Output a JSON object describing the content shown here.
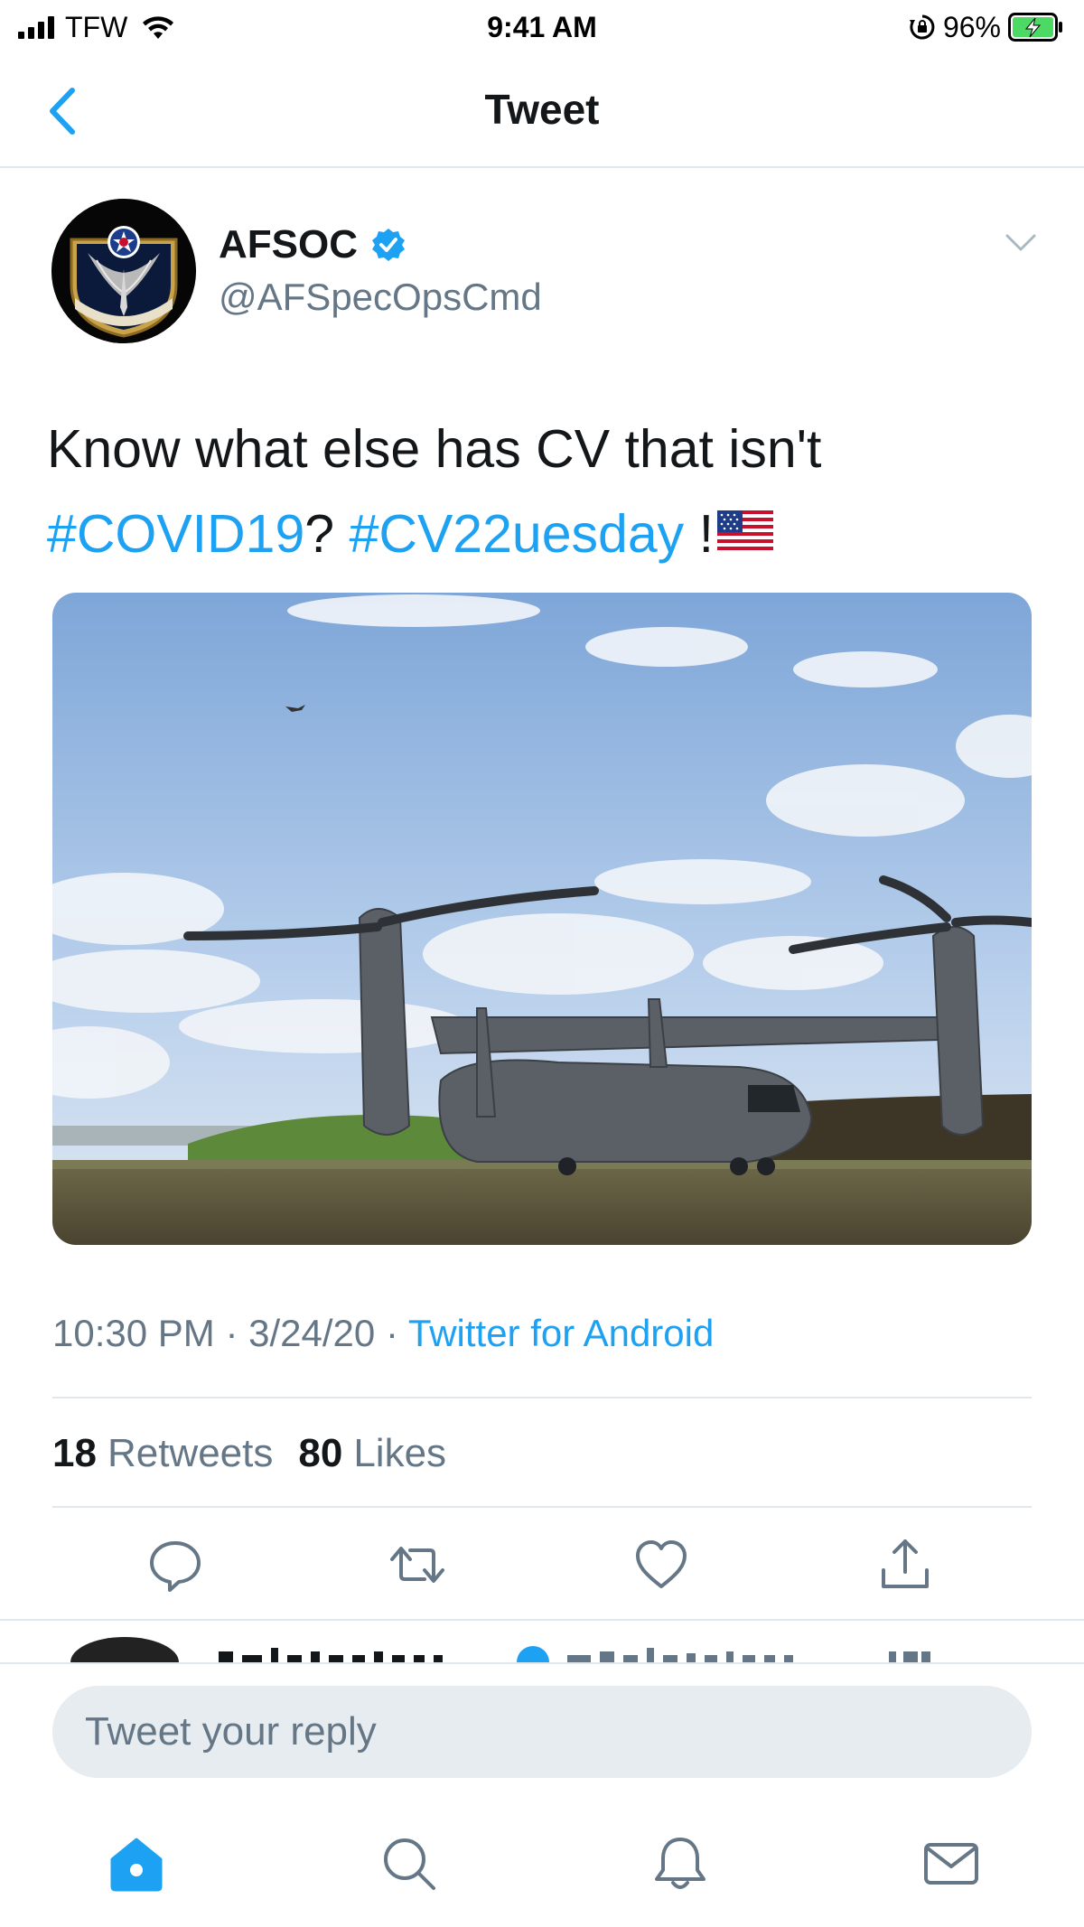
{
  "status_bar": {
    "carrier": "TFW",
    "time": "9:41 AM",
    "battery": "96%",
    "battery_color": "#4cd964"
  },
  "nav": {
    "title": "Tweet",
    "back_icon": "chevron-left-icon"
  },
  "tweet": {
    "author_name": "AFSOC",
    "author_handle": "@AFSpecOpsCmd",
    "verified": true,
    "text_plain": "Know what else has CV that isn't",
    "hashtag_1": "#COVID19",
    "separator": "?",
    "hashtag_2": "#CV22uesday",
    "exclaim": "!",
    "emoji": "us-flag-emoji",
    "time": "10:30 PM",
    "dot_1": "·",
    "date": "3/24/20",
    "dot_2": "·",
    "source": "Twitter for Android",
    "retweets_count": "18",
    "retweets_label": "Retweets",
    "likes_count": "80",
    "likes_label": "Likes"
  },
  "actions": [
    "reply-icon",
    "retweet-icon",
    "like-icon",
    "share-icon"
  ],
  "composer": {
    "placeholder": "Tweet your reply"
  },
  "tabbar": [
    "home-icon",
    "search-icon",
    "notifications-icon",
    "messages-icon"
  ],
  "colors": {
    "accent": "#1da1f2",
    "text": "#14171a",
    "secondary": "#657786",
    "border": "#e1e8ed"
  }
}
